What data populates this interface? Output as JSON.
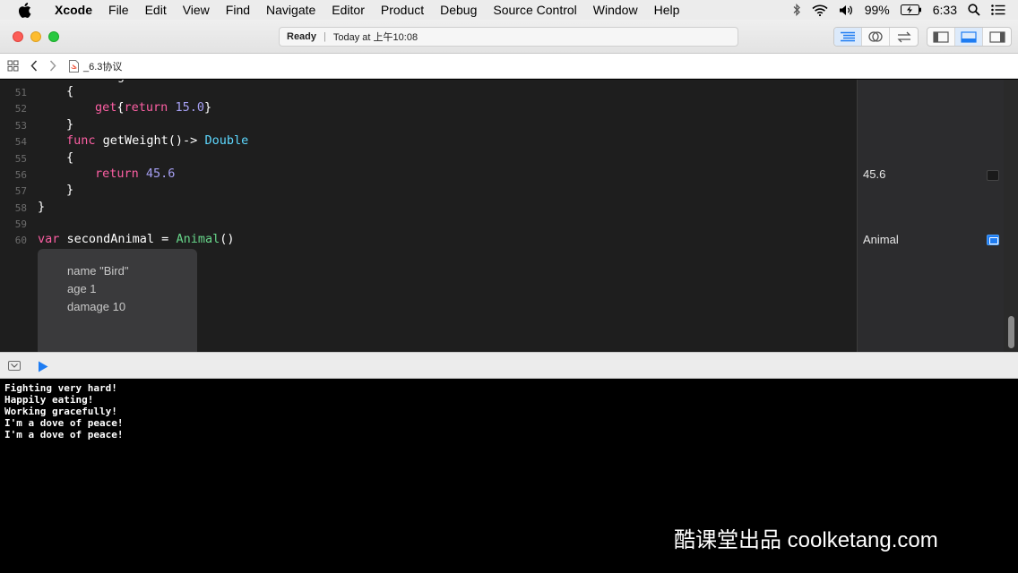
{
  "menubar": {
    "app": "Xcode",
    "items": [
      "File",
      "Edit",
      "View",
      "Find",
      "Navigate",
      "Editor",
      "Product",
      "Debug",
      "Source Control",
      "Window",
      "Help"
    ],
    "battery": "99%",
    "time": "6:33"
  },
  "toolbar": {
    "status": "Ready",
    "timestamp": "Today at 上午10:08"
  },
  "jumpbar": {
    "file": "_6.3协议"
  },
  "editor": {
    "lines": [
      {
        "num": "51"
      },
      {
        "num": "52"
      },
      {
        "num": "53"
      },
      {
        "num": "54"
      },
      {
        "num": "55"
      },
      {
        "num": "56"
      },
      {
        "num": "57"
      },
      {
        "num": "58"
      },
      {
        "num": "59"
      },
      {
        "num": "60"
      }
    ],
    "tokens": {
      "brace_open": "{",
      "brace_close": "}",
      "get": "get",
      "return": "return",
      "val_15": "15.0",
      "func": "func",
      "getWeight": " getWeight()-> ",
      "double": "Double",
      "val_45": "45.6",
      "var": "var",
      "secondAnimal": " secondAnimal = ",
      "animal": "Animal",
      "parens": "()"
    },
    "popup": [
      "name \"Bird\"",
      "age 1",
      "damage 10"
    ]
  },
  "results": {
    "line56": "45.6",
    "line60": "Animal"
  },
  "console": {
    "lines": [
      "Fighting very hard!",
      "Happily eating!",
      "Working gracefully!",
      "I'm a dove of peace!",
      "I'm a dove of peace!"
    ]
  },
  "watermark": "酷课堂出品 coolketang.com",
  "colors": {
    "keyword": "#fc5fa3",
    "number": "#a59ff2",
    "type": "#5dd8ff",
    "class": "#67d68a",
    "accent": "#1e7cf2"
  }
}
